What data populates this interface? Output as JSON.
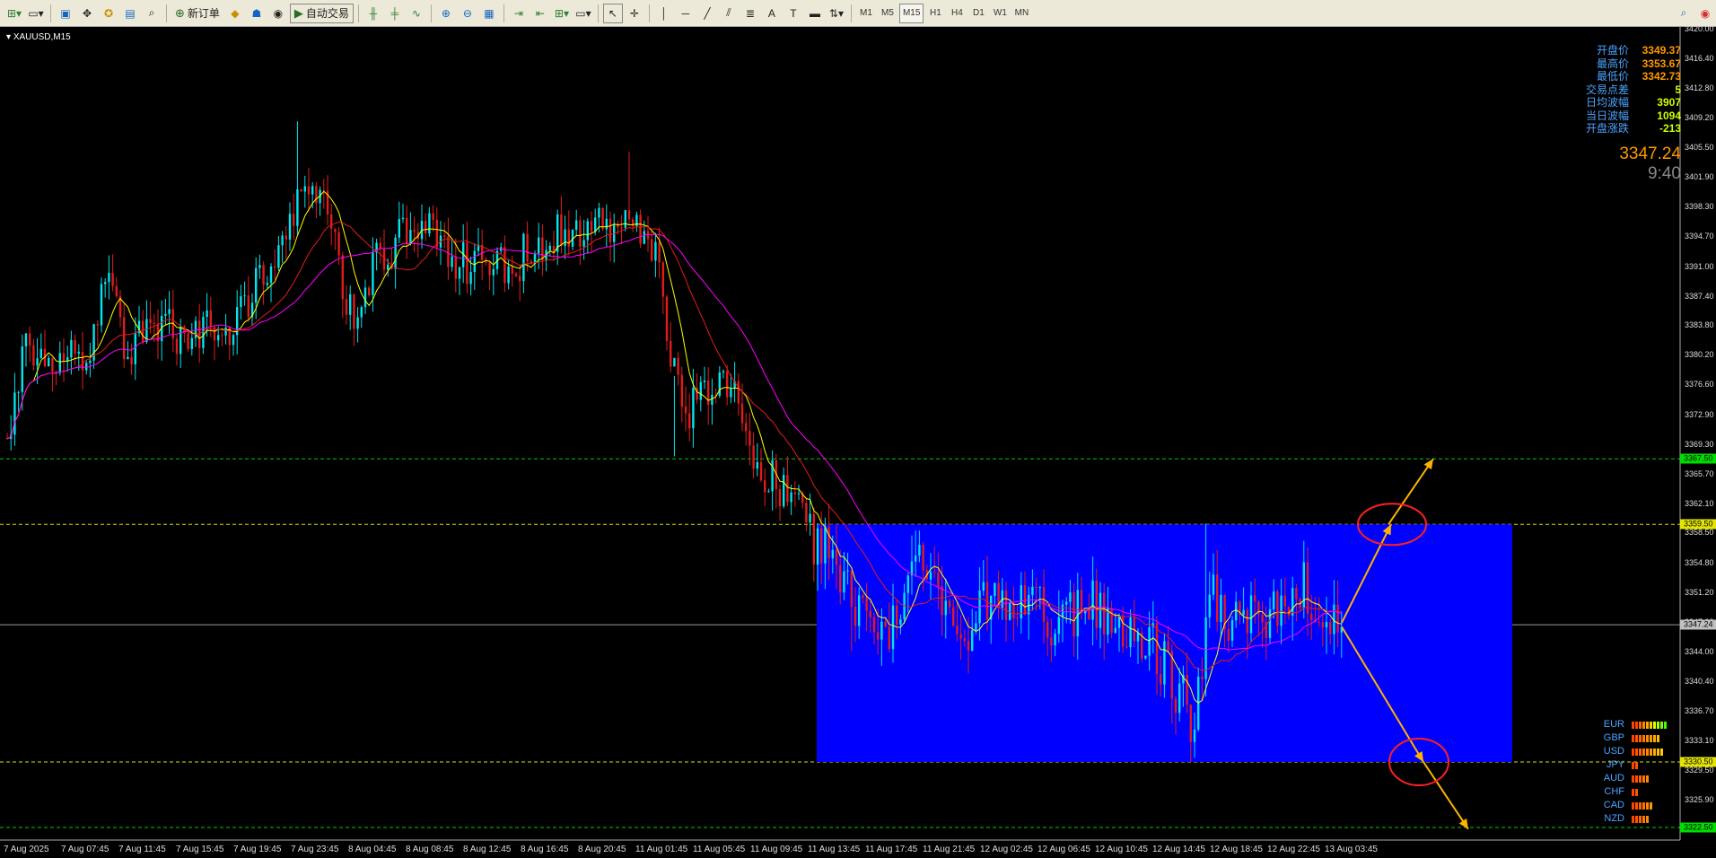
{
  "toolbar": {
    "new_order_label": "新订单",
    "auto_trading_label": "自动交易",
    "timeframes": [
      "M1",
      "M5",
      "M15",
      "H1",
      "H4",
      "D1",
      "W1",
      "MN"
    ],
    "active_timeframe": "M15"
  },
  "chart": {
    "symbol_label": "XAUUSD,M15",
    "background": "#000000",
    "bull_color": "#00e5ee",
    "bear_color": "#e31b1b",
    "range_box_color": "#0000ff",
    "arrow_color": "#ffb300",
    "circle_color": "#ff2020"
  },
  "info_panel": {
    "rows": [
      {
        "label": "开盘价",
        "value": "3349.37",
        "color": "#ff9900"
      },
      {
        "label": "最高价",
        "value": "3353.67",
        "color": "#ff9900"
      },
      {
        "label": "最低价",
        "value": "3342.73",
        "color": "#ff9900"
      },
      {
        "label": "交易点差",
        "value": "5",
        "color": "#ccff00"
      },
      {
        "label": "日均波幅",
        "value": "3907",
        "color": "#ccff00"
      },
      {
        "label": "当日波幅",
        "value": "1094",
        "color": "#ccff00"
      },
      {
        "label": "开盘涨跌",
        "value": "-213",
        "color": "#ccff00"
      }
    ],
    "current_price": "3347.24",
    "time": "9:40"
  },
  "currency_strength": [
    {
      "name": "EUR",
      "level": 10,
      "colors": [
        "#ff4400",
        "#ff4400",
        "#ff6600",
        "#ff8800",
        "#ffaa00",
        "#ffcc00",
        "#ddff00",
        "#aaff00",
        "#77ff00",
        "#44ff00"
      ]
    },
    {
      "name": "GBP",
      "level": 8
    },
    {
      "name": "USD",
      "level": 9
    },
    {
      "name": "JPY",
      "level": 2
    },
    {
      "name": "AUD",
      "level": 5
    },
    {
      "name": "CHF",
      "level": 2
    },
    {
      "name": "CAD",
      "level": 6
    },
    {
      "name": "NZD",
      "level": 5
    }
  ],
  "price_axis": {
    "ticks": [
      "3420.00",
      "3416.40",
      "3412.80",
      "3409.20",
      "3405.50",
      "3401.90",
      "3398.30",
      "3394.70",
      "3391.00",
      "3387.40",
      "3383.80",
      "3380.20",
      "3376.60",
      "3372.90",
      "3369.30",
      "3365.70",
      "3362.10",
      "3358.50",
      "3354.80",
      "3351.20",
      "3347.60",
      "3344.00",
      "3340.40",
      "3336.70",
      "3333.10",
      "3329.50",
      "3325.90"
    ],
    "tags": [
      {
        "text": "3367.50",
        "price": 3367.5,
        "color": "#00dd00",
        "line": "#00cc00"
      },
      {
        "text": "3359.50",
        "price": 3359.5,
        "color": "#e5e500",
        "line": "#dddd00"
      },
      {
        "text": "3347.24",
        "price": 3347.24,
        "color": "#c0c0c0",
        "line": "#9a9a9a"
      },
      {
        "text": "3330.50",
        "price": 3330.5,
        "color": "#e5e500",
        "line": "#dddd00"
      },
      {
        "text": "3322.50",
        "price": 3322.5,
        "color": "#00dd00",
        "line": "#00cc00"
      }
    ]
  },
  "time_axis": {
    "labels": [
      "7 Aug 2025",
      "7 Aug 07:45",
      "7 Aug 11:45",
      "7 Aug 15:45",
      "7 Aug 19:45",
      "7 Aug 23:45",
      "8 Aug 04:45",
      "8 Aug 08:45",
      "8 Aug 12:45",
      "8 Aug 16:45",
      "8 Aug 20:45",
      "11 Aug 01:45",
      "11 Aug 05:45",
      "11 Aug 09:45",
      "11 Aug 13:45",
      "11 Aug 17:45",
      "11 Aug 21:45",
      "12 Aug 02:45",
      "12 Aug 06:45",
      "12 Aug 10:45",
      "12 Aug 14:45",
      "12 Aug 18:45",
      "12 Aug 22:45",
      "13 Aug 03:45"
    ]
  }
}
